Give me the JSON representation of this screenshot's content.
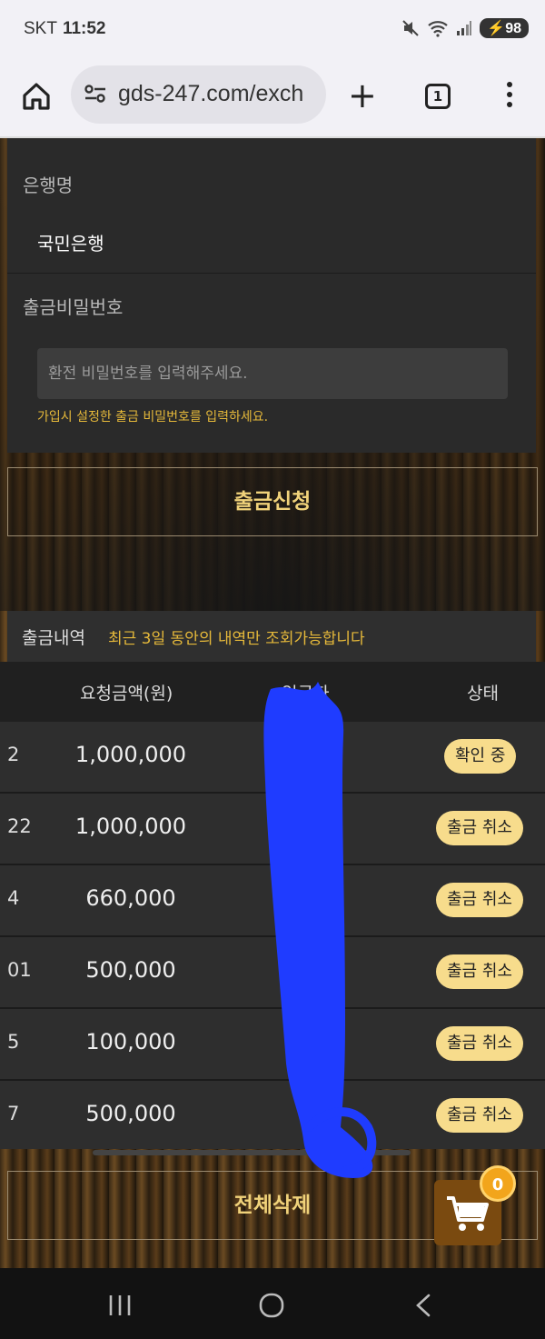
{
  "status": {
    "carrier": "SKT",
    "time": "11:52",
    "battery": "98"
  },
  "browser": {
    "url": "gds-247.com/exch",
    "tab_count": "1"
  },
  "form": {
    "bank_label": "은행명",
    "bank_value": "국민은행",
    "pw_label": "출금비밀번호",
    "pw_placeholder": "환전 비밀번호를 입력해주세요.",
    "pw_hint": "가입시 설정한 출금 비밀번호를 입력하세요."
  },
  "withdraw_button": "출금신청",
  "history": {
    "title": "출금내역",
    "note": "최근 3일 동안의 내역만 조회가능합니다",
    "columns": [
      "요청금액(원)",
      "입금자",
      "상태"
    ],
    "rows": [
      {
        "date": "2",
        "amount": "1,000,000",
        "status": "확인 중"
      },
      {
        "date": "22",
        "amount": "1,000,000",
        "status": "출금 취소"
      },
      {
        "date": "4",
        "amount": "660,000",
        "status": "출금 취소"
      },
      {
        "date": "01",
        "amount": "500,000",
        "status": "출금 취소"
      },
      {
        "date": "5",
        "amount": "100,000",
        "status": "출금 취소"
      },
      {
        "date": "7",
        "amount": "500,000",
        "status": "출금 취소"
      }
    ]
  },
  "delete_all_button": "전체삭제",
  "cart": {
    "count": "0"
  },
  "colors": {
    "accent_gold": "#f0d27a",
    "hint_yellow": "#e6b93a",
    "badge_bg": "#f7dc8c",
    "redaction_blue": "#1f3cff"
  },
  "icons": [
    "mute-icon",
    "wifi-icon",
    "signal-icon",
    "battery-icon",
    "home-icon",
    "site-settings-icon",
    "plus-icon",
    "tabs-icon",
    "more-menu-icon",
    "cart-icon",
    "recent-apps-icon",
    "home-nav-icon",
    "back-icon"
  ]
}
